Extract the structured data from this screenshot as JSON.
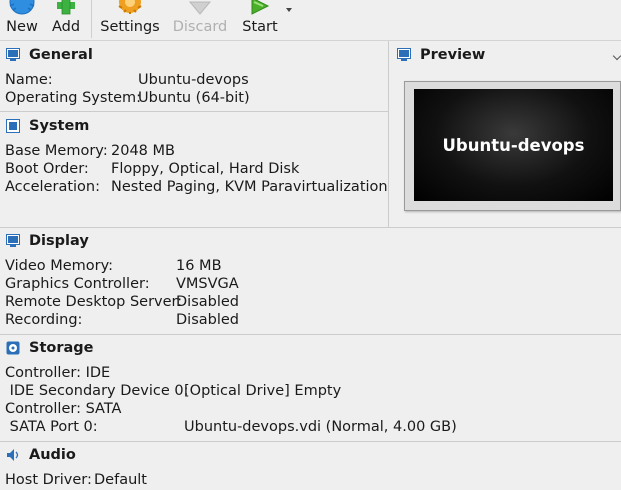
{
  "toolbar": {
    "new_label": "New",
    "add_label": "Add",
    "settings_label": "Settings",
    "discard_label": "Discard",
    "start_label": "Start"
  },
  "general": {
    "title": "General",
    "rows": [
      {
        "label": "Name:",
        "value": "Ubuntu-devops"
      },
      {
        "label": "Operating System:",
        "value": "Ubuntu (64-bit)"
      }
    ]
  },
  "preview": {
    "title": "Preview",
    "screen_text": "Ubuntu-devops"
  },
  "system": {
    "title": "System",
    "rows": [
      {
        "label": "Base Memory:",
        "value": "2048 MB"
      },
      {
        "label": "Boot Order:",
        "value": "Floppy, Optical, Hard Disk"
      },
      {
        "label": "Acceleration:",
        "value": "Nested Paging, KVM Paravirtualization"
      }
    ]
  },
  "display": {
    "title": "Display",
    "rows": [
      {
        "label": "Video Memory:",
        "value": "16 MB"
      },
      {
        "label": "Graphics Controller:",
        "value": "VMSVGA"
      },
      {
        "label": "Remote Desktop Server:",
        "value": "Disabled"
      },
      {
        "label": "Recording:",
        "value": "Disabled"
      }
    ]
  },
  "storage": {
    "title": "Storage",
    "rows": [
      {
        "label": "Controller: IDE",
        "value": ""
      },
      {
        "label": " IDE Secondary Device 0:",
        "value": "[Optical Drive] Empty"
      },
      {
        "label": "Controller: SATA",
        "value": ""
      },
      {
        "label": " SATA Port 0:",
        "value": "Ubuntu-devops.vdi (Normal, 4.00 GB)"
      }
    ]
  },
  "audio": {
    "title": "Audio",
    "rows": [
      {
        "label": "Host Driver:",
        "value": "Default"
      }
    ]
  },
  "colors": {
    "section_icon_blue": "#2a6fb8",
    "new_icon_blue": "#2f8ee0",
    "add_icon_green": "#3cb340",
    "settings_icon_orange": "#f0a020",
    "start_icon_green": "#4caf2a",
    "discard_icon_gray": "#c8c8c8"
  }
}
